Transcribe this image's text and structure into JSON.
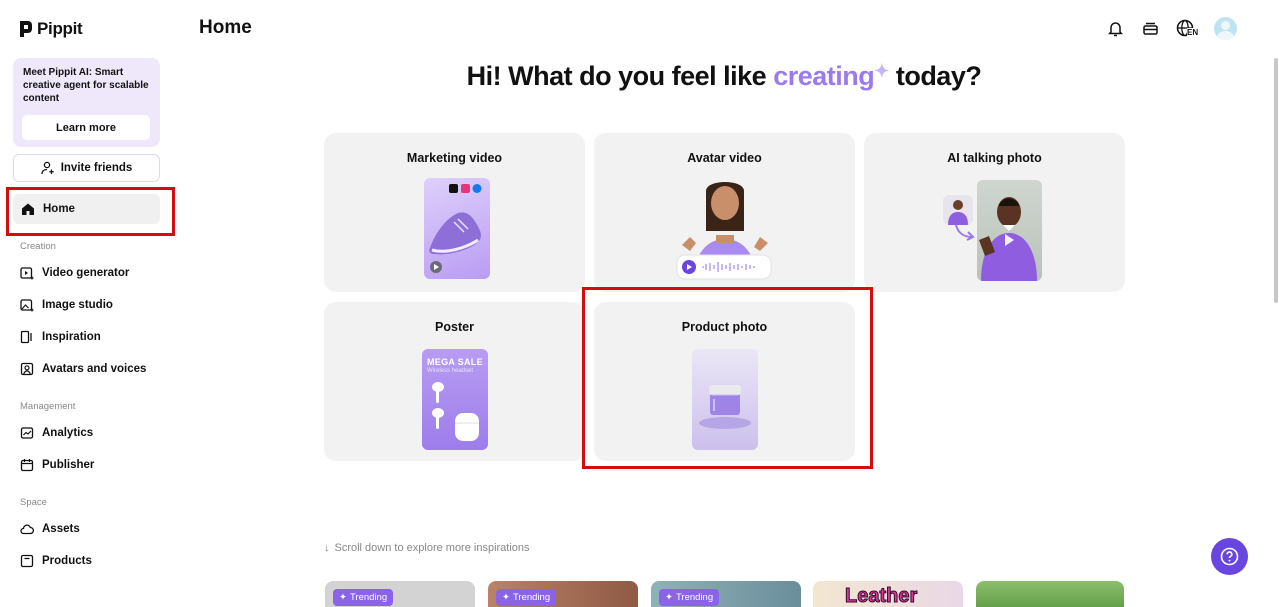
{
  "app": {
    "name": "Pippit"
  },
  "sidebar": {
    "promo_text": "Meet Pippit AI: Smart creative agent for scalable content",
    "promo_button": "Learn more",
    "invite_label": "Invite friends",
    "home_label": "Home",
    "sections": {
      "creation": "Creation",
      "management": "Management",
      "space": "Space"
    },
    "items": {
      "video_generator": "Video generator",
      "image_studio": "Image studio",
      "inspiration": "Inspiration",
      "avatars_voices": "Avatars and voices",
      "analytics": "Analytics",
      "publisher": "Publisher",
      "assets": "Assets",
      "products": "Products"
    }
  },
  "header": {
    "title": "Home",
    "lang": "EN"
  },
  "hero": {
    "prefix": "Hi! What do you feel like ",
    "accent": "creating",
    "suffix": " today?"
  },
  "cards": {
    "marketing_video": "Marketing video",
    "avatar_video": "Avatar video",
    "ai_talking_photo": "AI talking photo",
    "poster": "Poster",
    "product_photo": "Product photo"
  },
  "poster_thumb": {
    "headline": "MEGA SALE",
    "sub": "Wireless headset"
  },
  "scroll_hint": "Scroll down to explore more inspirations",
  "tiles": {
    "trending": "Trending",
    "leather": "Leather"
  },
  "colors": {
    "accent": "#9b7af0",
    "highlight": "#d40d0d",
    "help": "#6a46e0"
  }
}
